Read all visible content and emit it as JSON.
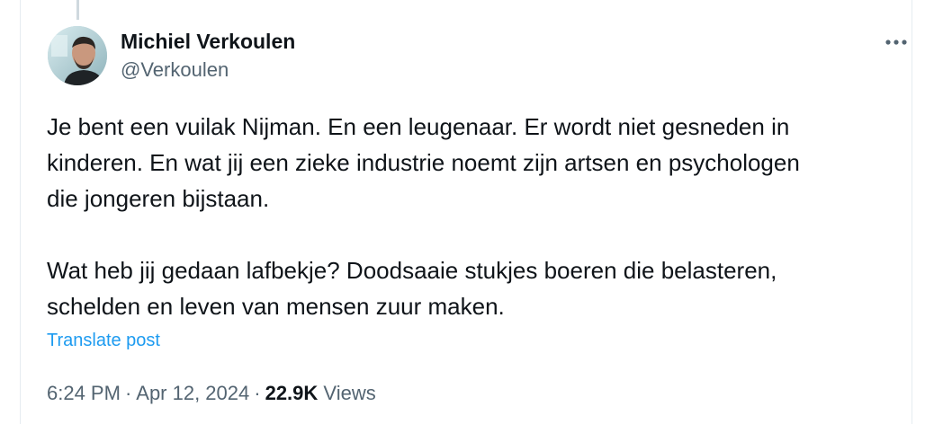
{
  "author": {
    "display_name": "Michiel Verkoulen",
    "handle": "@Verkoulen",
    "avatar_icon": "profile-photo"
  },
  "more_icon": "more-horizontal-icon",
  "tweet": {
    "paragraph_1": "Je bent een vuilak Nijman. En een leugenaar. Er wordt niet gesneden in\nkinderen. En wat jij een zieke industrie noemt zijn artsen en psychologen\ndie jongeren bijstaan.",
    "paragraph_2": "Wat heb jij gedaan lafbekje? Doodsaaie stukjes boeren die belasteren,\nschelden en leven van mensen zuur maken."
  },
  "translate_label": "Translate post",
  "meta": {
    "time": "6:24 PM",
    "date": "Apr 12, 2024",
    "separator": "·",
    "views_count": "22.9K",
    "views_label": "Views"
  },
  "colors": {
    "text": "#0f1419",
    "secondary": "#536471",
    "link": "#1d9bf0"
  }
}
